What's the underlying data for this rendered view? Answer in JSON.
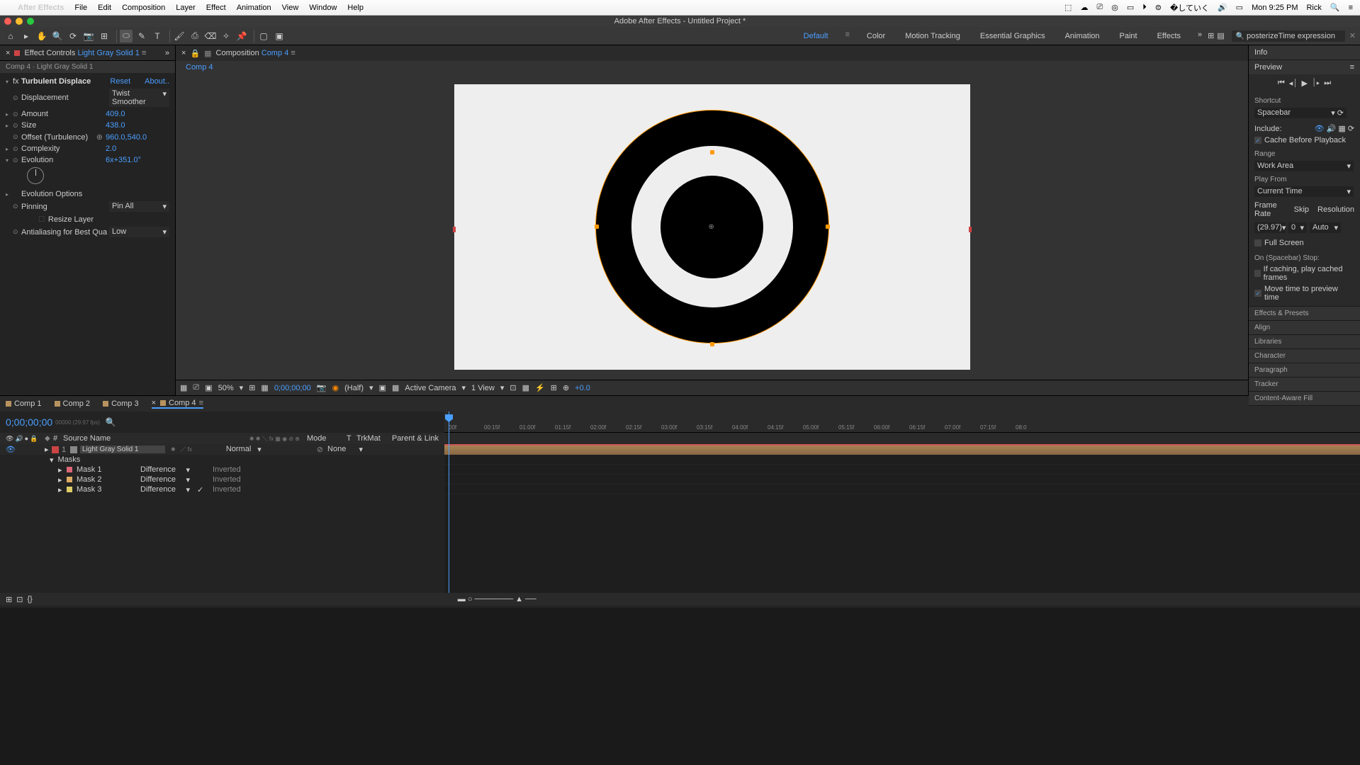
{
  "menubar": {
    "app": "After Effects",
    "items": [
      "File",
      "Edit",
      "Composition",
      "Layer",
      "Effect",
      "Animation",
      "View",
      "Window",
      "Help"
    ],
    "date": "Mon 9:25 PM",
    "user": "Rick"
  },
  "title": "Adobe After Effects - Untitled Project *",
  "workspaces": [
    "Default",
    "Color",
    "Motion Tracking",
    "Essential Graphics",
    "Animation",
    "Paint",
    "Effects"
  ],
  "search_placeholder": "posterizeTime expression",
  "effect_panel": {
    "tab": "Effect Controls",
    "layer": "Light Gray Solid 1",
    "subtitle": "Comp 4 · Light Gray Solid 1",
    "effect": "Turbulent Displace",
    "reset": "Reset",
    "about": "About..",
    "props": {
      "displacement": {
        "label": "Displacement",
        "value": "Twist Smoother"
      },
      "amount": {
        "label": "Amount",
        "value": "409.0"
      },
      "size": {
        "label": "Size",
        "value": "438.0"
      },
      "offset": {
        "label": "Offset (Turbulence)",
        "value": "960.0,540.0"
      },
      "complexity": {
        "label": "Complexity",
        "value": "2.0"
      },
      "evolution": {
        "label": "Evolution",
        "value": "6x+351.0°"
      },
      "evolution_options": {
        "label": "Evolution Options"
      },
      "pinning": {
        "label": "Pinning",
        "value": "Pin All"
      },
      "resize": {
        "label": "Resize Layer"
      },
      "antialias": {
        "label": "Antialiasing for Best Qua",
        "value": "Low"
      }
    }
  },
  "comp_panel": {
    "tab_prefix": "Composition",
    "tab_name": "Comp 4",
    "subtab": "Comp 4"
  },
  "viewer_bar": {
    "zoom": "50%",
    "time": "0;00;00;00",
    "res": "(Half)",
    "camera": "Active Camera",
    "view": "1 View",
    "exposure": "+0.0"
  },
  "right": {
    "info": "Info",
    "preview": "Preview",
    "shortcut_label": "Shortcut",
    "shortcut": "Spacebar",
    "include": "Include:",
    "cache": "Cache Before Playback",
    "range_label": "Range",
    "range": "Work Area",
    "playfrom_label": "Play From",
    "playfrom": "Current Time",
    "framerate_label": "Frame Rate",
    "skip_label": "Skip",
    "resolution_label": "Resolution",
    "framerate": "(29.97)",
    "skip": "0",
    "resolution": "Auto",
    "fullscreen": "Full Screen",
    "onstop": "On (Spacebar) Stop:",
    "ifcaching": "If caching, play cached frames",
    "movetime": "Move time to preview time",
    "panels": [
      "Effects & Presets",
      "Align",
      "Libraries",
      "Character",
      "Paragraph",
      "Tracker",
      "Content-Aware Fill"
    ]
  },
  "timeline": {
    "tabs": [
      "Comp 1",
      "Comp 2",
      "Comp 3",
      "Comp 4"
    ],
    "timecode": "0;00;00;00",
    "timecode_sub": "00000 (29.97 fps)",
    "col_source": "Source Name",
    "col_mode": "Mode",
    "col_t": "T",
    "col_trkmat": "TrkMat",
    "col_parent": "Parent & Link",
    "layer": {
      "num": "1",
      "name": "Light Gray Solid 1",
      "mode": "Normal",
      "parent": "None"
    },
    "masks_label": "Masks",
    "masks": [
      {
        "name": "Mask 1",
        "mode": "Difference",
        "inverted": "Inverted",
        "checked": false,
        "color": "#d67"
      },
      {
        "name": "Mask 2",
        "mode": "Difference",
        "inverted": "Inverted",
        "checked": false,
        "color": "#da6"
      },
      {
        "name": "Mask 3",
        "mode": "Difference",
        "inverted": "Inverted",
        "checked": true,
        "color": "#dc6"
      }
    ],
    "ruler": [
      "00f",
      "00:15f",
      "01:00f",
      "01:15f",
      "02:00f",
      "02:15f",
      "03:00f",
      "03:15f",
      "04:00f",
      "04:15f",
      "05:00f",
      "05:15f",
      "06:00f",
      "06:15f",
      "07:00f",
      "07:15f",
      "08:0"
    ]
  }
}
